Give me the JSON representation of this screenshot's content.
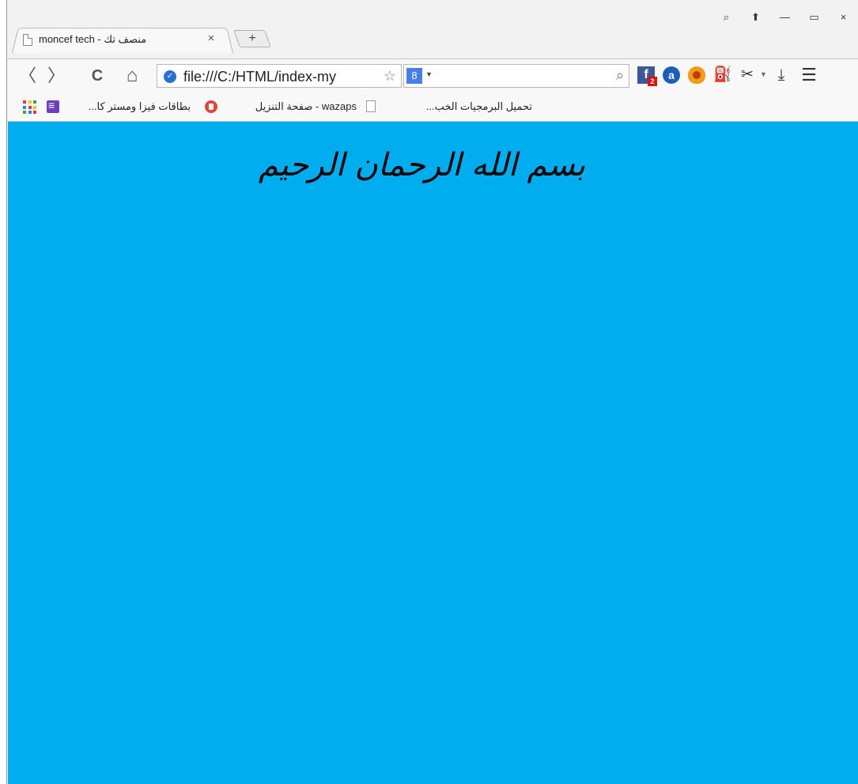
{
  "browser": {
    "tab": {
      "title": "moncef tech - منصف تك",
      "close_label": "×"
    },
    "new_tab_label": "+",
    "window_controls": {
      "feedback": "⌕",
      "pin": "⬆",
      "minimize": "—",
      "maximize": "▭",
      "close": "×"
    },
    "nav": {
      "back": "〈",
      "forward": "〉",
      "reload": "C",
      "home": "⌂"
    },
    "address": {
      "url": "file:///C:/HTML/index-my"
    },
    "search": {
      "engine_icon": "8",
      "placeholder": ""
    },
    "extensions": [
      {
        "name": "facebook-icon",
        "badge": "2"
      },
      {
        "name": "a-icon",
        "label": "a"
      },
      {
        "name": "fire-icon"
      },
      {
        "name": "download-manager-icon"
      },
      {
        "name": "scissors-icon"
      },
      {
        "name": "download-icon"
      },
      {
        "name": "menu-icon"
      }
    ],
    "bookmarks": [
      {
        "label": "بطاقات فيزا ومستر كا..."
      },
      {
        "label": "wazaps - صفحة التنزيل"
      },
      {
        "label": "تحميل البرمجيات الخب..."
      }
    ]
  },
  "page": {
    "heading": "بسم الله الرحمان الرحيم",
    "background_color": "#00adef"
  },
  "colors": {
    "page_bg": "#00adef",
    "chrome_bg": "#f2f2f2",
    "facebook": "#3b5998"
  }
}
